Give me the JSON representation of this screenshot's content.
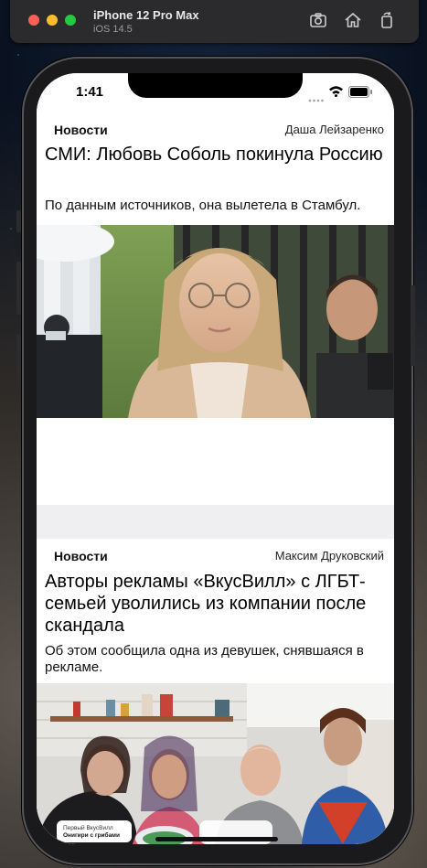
{
  "simulator": {
    "device": "iPhone 12 Pro Max",
    "os": "iOS 14.5",
    "icons": [
      "screenshot-icon",
      "home-icon",
      "rotate-icon"
    ]
  },
  "status_bar": {
    "time": "1:41"
  },
  "articles": [
    {
      "category": "Новости",
      "author": "Даша Лейзаренко",
      "title": "СМИ: Любовь Соболь покинула Россию",
      "lead": "По данным источников, она вылетела в Стамбул."
    },
    {
      "category": "Новости",
      "author": "Максим Друковский",
      "title": "Авторы рекламы «ВкусВилл» с ЛГБТ-семьей уволились из компании после скандала",
      "lead": "Об этом сообщила одна из девушек, снявшаяся в рекламе.",
      "photo_caption_line1": "Первый ВкусВилл",
      "photo_caption_line2": "Онигири с грибами"
    }
  ]
}
